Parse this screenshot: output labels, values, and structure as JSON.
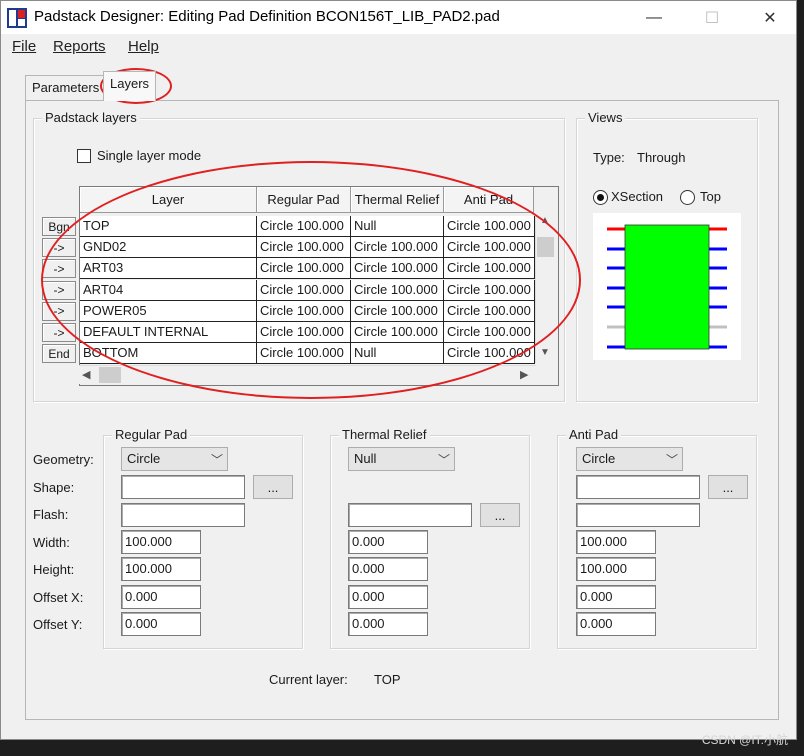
{
  "window": {
    "title": "Padstack Designer: Editing Pad Definition BCON156T_LIB_PAD2.pad",
    "minimize_icon": "—",
    "maximize_icon": "☐",
    "close_icon": "✕"
  },
  "menu": {
    "file": "File",
    "reports": "Reports",
    "help": "Help"
  },
  "tabs": {
    "parameters": "Parameters",
    "layers": "Layers"
  },
  "padstack_layers": {
    "group_label": "Padstack layers",
    "single_layer_mode": "Single layer mode",
    "columns": [
      "Layer",
      "Regular Pad",
      "Thermal Relief",
      "Anti Pad"
    ],
    "rows": [
      {
        "btn": "Bgn",
        "layer": "TOP",
        "regular": "Circle 100.000",
        "thermal": "Null",
        "anti": "Circle 100.000"
      },
      {
        "btn": "->",
        "layer": "GND02",
        "regular": "Circle 100.000",
        "thermal": "Circle 100.000",
        "anti": "Circle 100.000"
      },
      {
        "btn": "->",
        "layer": "ART03",
        "regular": "Circle 100.000",
        "thermal": "Circle 100.000",
        "anti": "Circle 100.000"
      },
      {
        "btn": "->",
        "layer": "ART04",
        "regular": "Circle 100.000",
        "thermal": "Circle 100.000",
        "anti": "Circle 100.000"
      },
      {
        "btn": "->",
        "layer": "POWER05",
        "regular": "Circle 100.000",
        "thermal": "Circle 100.000",
        "anti": "Circle 100.000"
      },
      {
        "btn": "->",
        "layer": "DEFAULT INTERNAL",
        "regular": "Circle 100.000",
        "thermal": "Circle 100.000",
        "anti": "Circle 100.000"
      },
      {
        "btn": "End",
        "layer": "BOTTOM",
        "regular": "Circle 100.000",
        "thermal": "Null",
        "anti": "Circle 100.000"
      }
    ]
  },
  "views": {
    "group_label": "Views",
    "type_label": "Type:",
    "type_value": "Through",
    "xsection_label": "XSection",
    "top_label": "Top",
    "pad_color": "#00ff00",
    "top_layer_color": "#ff0000",
    "inner_layer_color": "#0000ff",
    "plane_layer_color": "#c0c0c0"
  },
  "field_labels": {
    "geometry": "Geometry:",
    "shape": "Shape:",
    "flash": "Flash:",
    "width": "Width:",
    "height": "Height:",
    "offset_x": "Offset X:",
    "offset_y": "Offset Y:"
  },
  "regular_pad": {
    "label": "Regular Pad",
    "geometry": "Circle",
    "shape": "",
    "flash": "",
    "width": "100.000",
    "height": "100.000",
    "offset_x": "0.000",
    "offset_y": "0.000"
  },
  "thermal_relief": {
    "label": "Thermal Relief",
    "geometry": "Null",
    "flash": "",
    "width": "0.000",
    "height": "0.000",
    "offset_x": "0.000",
    "offset_y": "0.000"
  },
  "anti_pad": {
    "label": "Anti Pad",
    "geometry": "Circle",
    "shape": "",
    "flash": "",
    "width": "100.000",
    "height": "100.000",
    "offset_x": "0.000",
    "offset_y": "0.000"
  },
  "browse_label": "...",
  "current_layer": {
    "label": "Current layer:",
    "value": "TOP"
  },
  "watermark": "CSDN @IT.小航"
}
